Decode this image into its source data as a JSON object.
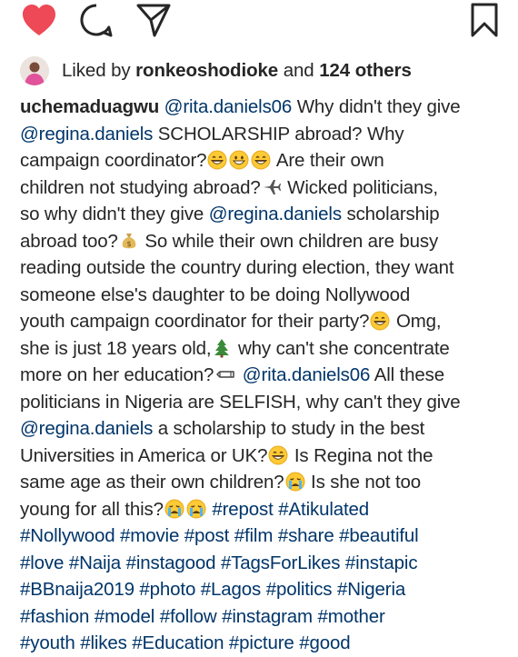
{
  "colors": {
    "heart": "#ed4956",
    "text": "#262626",
    "link": "#003569",
    "icon": "#262626"
  },
  "actions": [
    {
      "name": "like-icon",
      "state": "liked"
    },
    {
      "name": "comment-icon"
    },
    {
      "name": "share-icon"
    },
    {
      "name": "save-icon"
    }
  ],
  "likes": {
    "prefix": "Liked by ",
    "user": "ronkeoshodioke",
    "middle": " and ",
    "others": "124 others"
  },
  "caption": {
    "username": "uchemaduagwu",
    "lines": [
      [
        {
          "t": "user",
          "v": "uchemaduagwu"
        },
        {
          "t": "text",
          "v": " "
        },
        {
          "t": "mention",
          "v": "@rita.daniels06"
        },
        {
          "t": "text",
          "v": " Why didn't they give"
        }
      ],
      [
        {
          "t": "mention",
          "v": "@regina.daniels"
        },
        {
          "t": "text",
          "v": " SCHOLARSHIP abroad? Why"
        }
      ],
      [
        {
          "t": "text",
          "v": "campaign coordinator?"
        },
        {
          "t": "emoji",
          "v": "grin"
        },
        {
          "t": "emoji",
          "v": "smile"
        },
        {
          "t": "emoji",
          "v": "grin"
        },
        {
          "t": "text",
          "v": " Are their own"
        }
      ],
      [
        {
          "t": "text",
          "v": "children not studying abroad?"
        },
        {
          "t": "emoji",
          "v": "plane"
        },
        {
          "t": "text",
          "v": " Wicked politicians,"
        }
      ],
      [
        {
          "t": "text",
          "v": "so why didn't they give "
        },
        {
          "t": "mention",
          "v": "@regina.daniels"
        },
        {
          "t": "text",
          "v": " scholarship"
        }
      ],
      [
        {
          "t": "text",
          "v": "abroad too?"
        },
        {
          "t": "emoji",
          "v": "moneybag"
        },
        {
          "t": "text",
          "v": " So while their own children are busy"
        }
      ],
      [
        {
          "t": "text",
          "v": "reading outside the country during election, they want"
        }
      ],
      [
        {
          "t": "text",
          "v": "someone else's daughter to be doing Nollywood"
        }
      ],
      [
        {
          "t": "text",
          "v": "youth campaign coordinator for their party?"
        },
        {
          "t": "emoji",
          "v": "grin"
        },
        {
          "t": "text",
          "v": " Omg,"
        }
      ],
      [
        {
          "t": "text",
          "v": "she is just 18 years old,"
        },
        {
          "t": "emoji",
          "v": "tree"
        },
        {
          "t": "text",
          "v": " why can't she concentrate"
        }
      ],
      [
        {
          "t": "text",
          "v": "more on her education?"
        },
        {
          "t": "emoji",
          "v": "pencil"
        },
        {
          "t": "text",
          "v": " "
        },
        {
          "t": "mention",
          "v": "@rita.daniels06"
        },
        {
          "t": "text",
          "v": " All these"
        }
      ],
      [
        {
          "t": "text",
          "v": "politicians in Nigeria are SELFISH, why can't they give"
        }
      ],
      [
        {
          "t": "mention",
          "v": "@regina.daniels"
        },
        {
          "t": "text",
          "v": " a scholarship to study in the best"
        }
      ],
      [
        {
          "t": "text",
          "v": "Universities in America or UK?"
        },
        {
          "t": "emoji",
          "v": "grin"
        },
        {
          "t": "text",
          "v": " Is Regina not the"
        }
      ],
      [
        {
          "t": "text",
          "v": "same age as their own children?"
        },
        {
          "t": "emoji",
          "v": "cry"
        },
        {
          "t": "text",
          "v": " Is she not too"
        }
      ],
      [
        {
          "t": "text",
          "v": "young for all this?"
        },
        {
          "t": "emoji",
          "v": "cry"
        },
        {
          "t": "emoji",
          "v": "cry"
        },
        {
          "t": "text",
          "v": " "
        },
        {
          "t": "tag",
          "v": "#repost"
        },
        {
          "t": "text",
          "v": " "
        },
        {
          "t": "tag",
          "v": "#Atikulated"
        }
      ],
      [
        {
          "t": "tag",
          "v": "#Nollywood"
        },
        {
          "t": "text",
          "v": " "
        },
        {
          "t": "tag",
          "v": "#movie"
        },
        {
          "t": "text",
          "v": " "
        },
        {
          "t": "tag",
          "v": "#post"
        },
        {
          "t": "text",
          "v": " "
        },
        {
          "t": "tag",
          "v": "#film"
        },
        {
          "t": "text",
          "v": " "
        },
        {
          "t": "tag",
          "v": "#share"
        },
        {
          "t": "text",
          "v": " "
        },
        {
          "t": "tag",
          "v": "#beautiful"
        }
      ],
      [
        {
          "t": "tag",
          "v": "#love"
        },
        {
          "t": "text",
          "v": " "
        },
        {
          "t": "tag",
          "v": "#Naija"
        },
        {
          "t": "text",
          "v": " "
        },
        {
          "t": "tag",
          "v": "#instagood"
        },
        {
          "t": "text",
          "v": " "
        },
        {
          "t": "tag",
          "v": "#TagsForLikes"
        },
        {
          "t": "text",
          "v": " "
        },
        {
          "t": "tag",
          "v": "#instapic"
        }
      ],
      [
        {
          "t": "tag",
          "v": "#BBnaija2019"
        },
        {
          "t": "text",
          "v": " "
        },
        {
          "t": "tag",
          "v": "#photo"
        },
        {
          "t": "text",
          "v": " "
        },
        {
          "t": "tag",
          "v": "#Lagos"
        },
        {
          "t": "text",
          "v": " "
        },
        {
          "t": "tag",
          "v": "#politics"
        },
        {
          "t": "text",
          "v": " "
        },
        {
          "t": "tag",
          "v": "#Nigeria"
        }
      ],
      [
        {
          "t": "tag",
          "v": "#fashion"
        },
        {
          "t": "text",
          "v": " "
        },
        {
          "t": "tag",
          "v": "#model"
        },
        {
          "t": "text",
          "v": " "
        },
        {
          "t": "tag",
          "v": "#follow"
        },
        {
          "t": "text",
          "v": " "
        },
        {
          "t": "tag",
          "v": "#instagram"
        },
        {
          "t": "text",
          "v": " "
        },
        {
          "t": "tag",
          "v": "#mother"
        }
      ],
      [
        {
          "t": "tag",
          "v": "#youth"
        },
        {
          "t": "text",
          "v": " "
        },
        {
          "t": "tag",
          "v": "#likes"
        },
        {
          "t": "text",
          "v": " "
        },
        {
          "t": "tag",
          "v": "#Education"
        },
        {
          "t": "text",
          "v": " "
        },
        {
          "t": "tag",
          "v": "#picture"
        },
        {
          "t": "text",
          "v": " "
        },
        {
          "t": "tag",
          "v": "#good"
        }
      ]
    ]
  }
}
